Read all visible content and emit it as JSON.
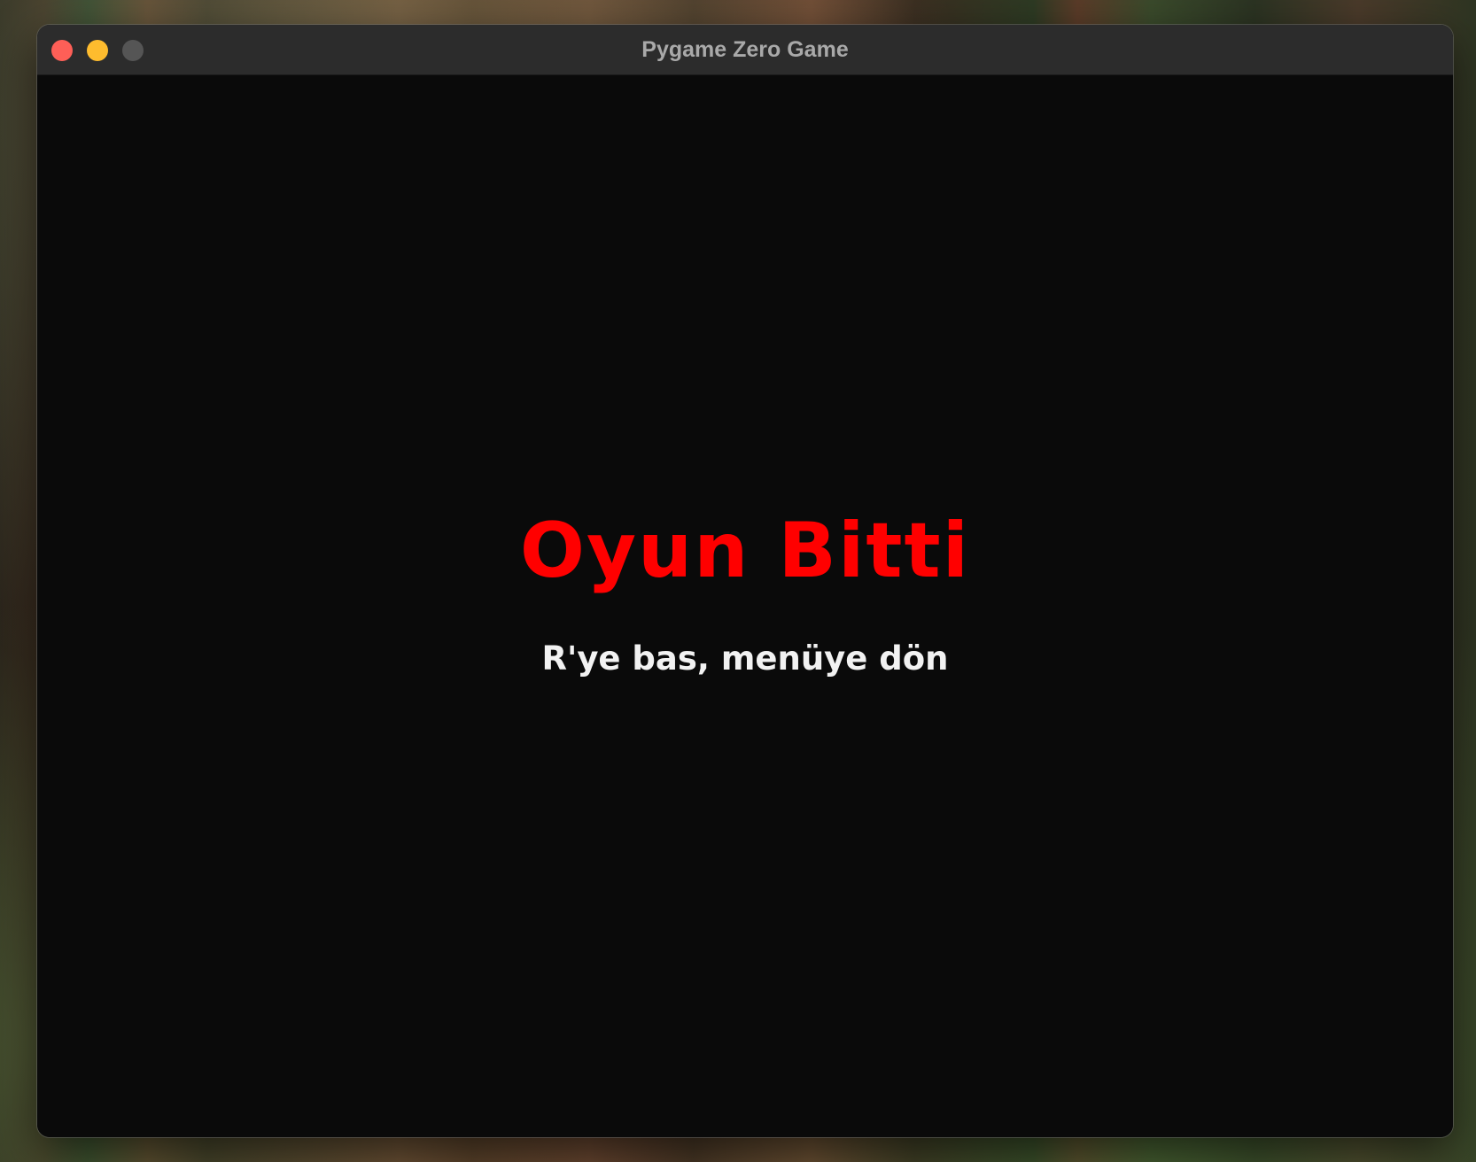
{
  "window": {
    "title": "Pygame Zero Game",
    "controls": {
      "close": "close-button",
      "minimize": "minimize-button",
      "zoom": "zoom-button"
    }
  },
  "game": {
    "headline": "Oyun Bitti",
    "instruction": "R'ye bas, menüye dön"
  },
  "colors": {
    "headline": "#ff0000",
    "instruction": "#f2f2f2",
    "canvas_background": "#0a0a0a",
    "titlebar": "#2c2c2c",
    "close": "#fe5f57",
    "minimize": "#febc2e",
    "zoom_inactive": "#555555"
  }
}
